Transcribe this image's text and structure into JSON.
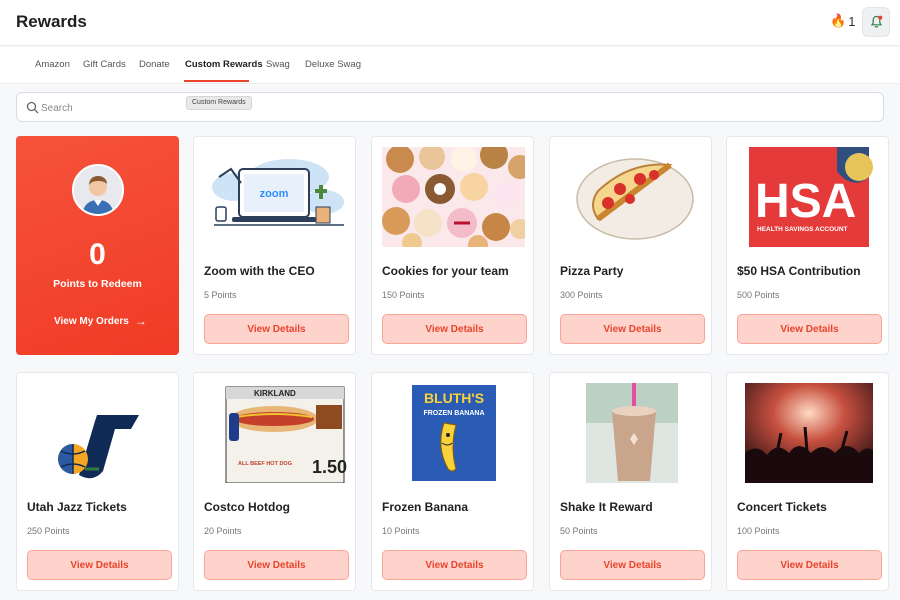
{
  "header": {
    "title": "Rewards",
    "streak_count": "1"
  },
  "tabs": [
    {
      "label": "Amazon"
    },
    {
      "label": "Gift Cards"
    },
    {
      "label": "Donate"
    },
    {
      "label": "Custom Rewards"
    },
    {
      "label": "Swag"
    },
    {
      "label": "Deluxe Swag"
    }
  ],
  "tooltip": "Custom Rewards",
  "search": {
    "placeholder": "Search"
  },
  "points_card": {
    "points": "0",
    "label": "Points to Redeem",
    "orders_link": "View My Orders"
  },
  "accent_color": "#e8442c",
  "rewards": [
    {
      "name": "Zoom with the CEO",
      "points": "5 Points",
      "button": "View Details",
      "image": "zoom-laptop-illustration",
      "image_text": "zoom"
    },
    {
      "name": "Cookies for your team",
      "points": "150 Points",
      "button": "View Details",
      "image": "cookies-photo"
    },
    {
      "name": "Pizza Party",
      "points": "300 Points",
      "button": "View Details",
      "image": "pizza-slice-illustration"
    },
    {
      "name": "$50 HSA Contribution",
      "points": "500 Points",
      "button": "View Details",
      "image": "hsa-graphic",
      "image_text": "HSA",
      "image_subtext": "HEALTH SAVINGS ACCOUNT"
    },
    {
      "name": "Utah Jazz Tickets",
      "points": "250 Points",
      "button": "View Details",
      "image": "utah-jazz-logo"
    },
    {
      "name": "Costco Hotdog",
      "points": "20 Points",
      "button": "View Details",
      "image": "hotdog-photo",
      "image_text": "KIRKLAND",
      "image_subtext": "1.50"
    },
    {
      "name": "Frozen Banana",
      "points": "10 Points",
      "button": "View Details",
      "image": "bluths-frozen-banana-sign",
      "image_text": "BLUTH'S",
      "image_subtext": "FROZEN BANANA"
    },
    {
      "name": "Shake It Reward",
      "points": "50 Points",
      "button": "View Details",
      "image": "milkshake-photo"
    },
    {
      "name": "Concert Tickets",
      "points": "100 Points",
      "button": "View Details",
      "image": "concert-crowd-photo"
    }
  ]
}
